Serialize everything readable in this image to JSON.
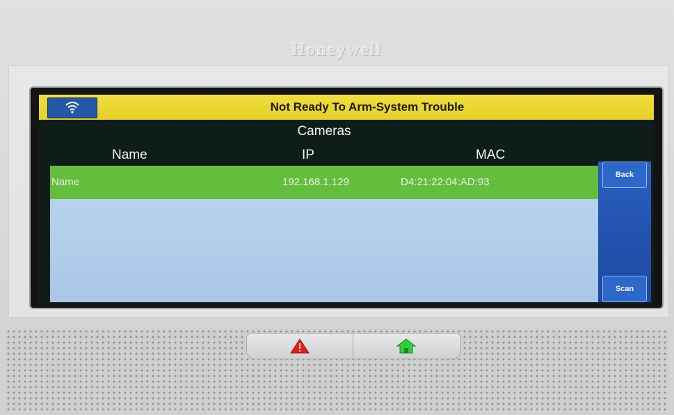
{
  "device": {
    "brand": "Honeywell"
  },
  "status_bar": {
    "message": "Not Ready To Arm-System Trouble",
    "wifi_icon": "wifi-icon"
  },
  "cameras": {
    "title": "Cameras",
    "columns": [
      "Name",
      "IP",
      "MAC"
    ],
    "rows": [
      {
        "name": "Name",
        "ip": "192.168.1.129",
        "mac": "D4:21:22:04:AD:93"
      }
    ]
  },
  "side_panel": {
    "back_label": "Back",
    "scan_label": "Scan"
  },
  "hardware_buttons": {
    "panic_icon": "alert-triangle-icon",
    "home_icon": "home-icon"
  },
  "colors": {
    "status_bar": "#e6d02a",
    "selected_row": "#63be3e",
    "list_background": "#bcd6ef",
    "side_panel": "#2a5fc0",
    "panic": "#e0201a",
    "home": "#2fcf3a"
  }
}
